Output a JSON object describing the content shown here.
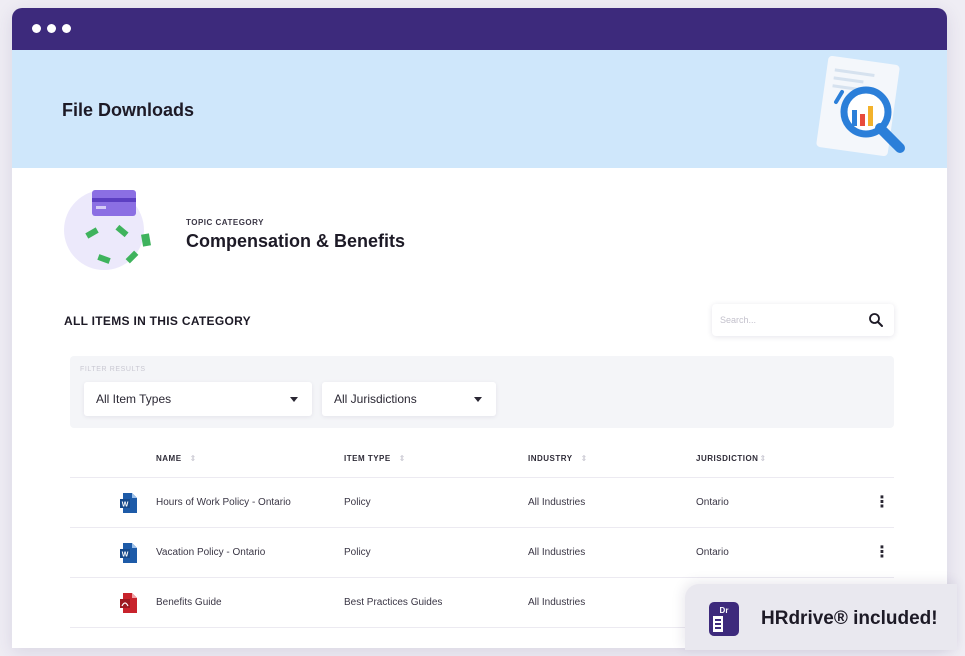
{
  "window": {
    "title_dots": 3
  },
  "banner": {
    "title": "File Downloads"
  },
  "category": {
    "eyebrow": "TOPIC CATEGORY",
    "title": "Compensation & Benefits"
  },
  "list": {
    "section_label": "ALL ITEMS IN THIS CATEGORY",
    "search_placeholder": "Search..."
  },
  "filters": {
    "label": "FILTER RESULTS",
    "item_type": "All Item Types",
    "jurisdiction": "All Jurisdictions"
  },
  "table": {
    "headers": {
      "name": "NAME",
      "item_type": "ITEM TYPE",
      "industry": "INDUSTRY",
      "jurisdiction": "JURISDICTION"
    },
    "rows": [
      {
        "name": "Hours of Work Policy - Ontario",
        "item_type": "Policy",
        "industry": "All Industries",
        "jurisdiction": "Ontario",
        "icon": "word-doc-icon"
      },
      {
        "name": "Vacation Policy - Ontario",
        "item_type": "Policy",
        "industry": "All Industries",
        "jurisdiction": "Ontario",
        "icon": "word-doc-icon"
      },
      {
        "name": "Benefits Guide",
        "item_type": "Best Practices Guides",
        "industry": "All Industries",
        "jurisdiction": "",
        "icon": "pdf-doc-icon"
      }
    ]
  },
  "badge": {
    "logo_text": "Dr",
    "text": "HRdrive® included!"
  },
  "colors": {
    "titlebar": "#3d2a7c",
    "banner": "#cfe7fb",
    "word_blue": "#1e5ba8",
    "pdf_red": "#c8232c"
  }
}
